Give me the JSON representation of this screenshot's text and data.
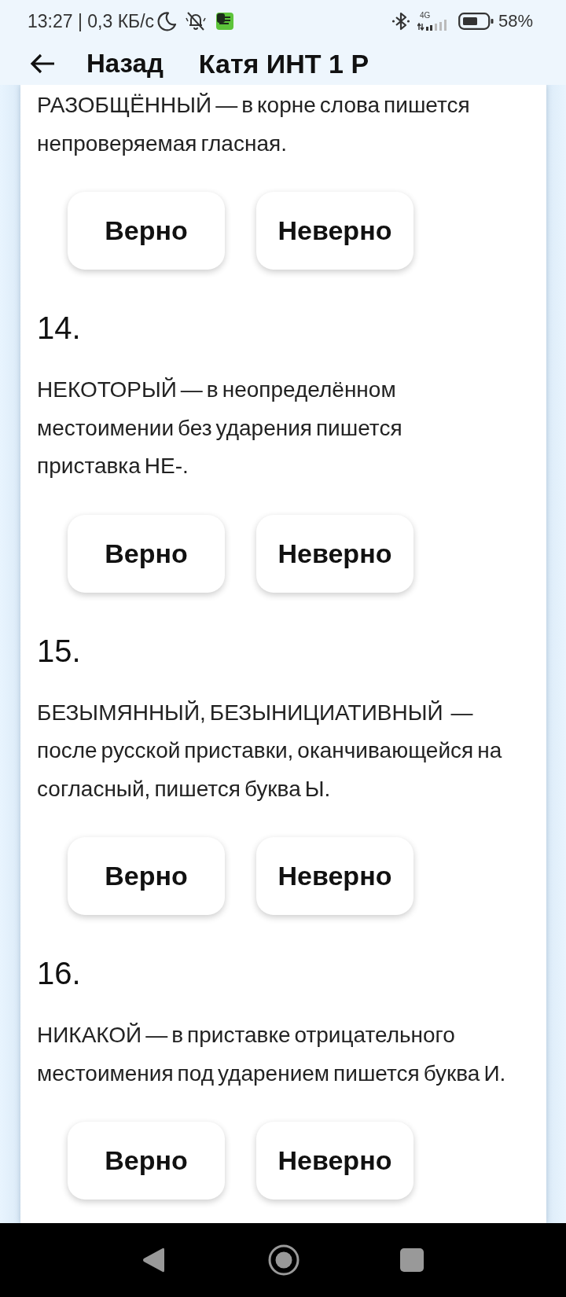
{
  "status_bar": {
    "text": "13:27 | 0,3 КБ/с",
    "network_type": "4G",
    "battery": "58%"
  },
  "header": {
    "back_label": "Назад",
    "title": "Катя ИНТ 1 Р"
  },
  "questions": [
    {
      "statement": "РАЗОБЩЁННЫЙ — в корне слова пишется непроверяемая гласная.",
      "answers": [
        {
          "label": "Верно",
          "selected": false
        },
        {
          "label": "Неверно",
          "selected": false
        }
      ]
    },
    {
      "number": "14.",
      "statement": "НЕКОТОРЫЙ — в неопределённом местоимении без ударения пишется приставка НЕ-.",
      "answers": [
        {
          "label": "Верно",
          "selected": false
        },
        {
          "label": "Неверно",
          "selected": false
        }
      ]
    },
    {
      "number": "15.",
      "statement": "БЕЗЫМЯННЫЙ, БЕЗЫНИЦИАТИВНЫЙ  — после русской приставки, оканчивающейся на согласный, пишется буква Ы.",
      "answers": [
        {
          "label": "Верно",
          "selected": false
        },
        {
          "label": "Неверно",
          "selected": false
        }
      ]
    },
    {
      "number": "16.",
      "statement": "НИКАКОЙ — в приставке отрицательного местоимения под ударением пишется буква И.",
      "answers": [
        {
          "label": "Верно",
          "selected": false
        },
        {
          "label": "Неверно",
          "selected": false
        }
      ]
    }
  ]
}
